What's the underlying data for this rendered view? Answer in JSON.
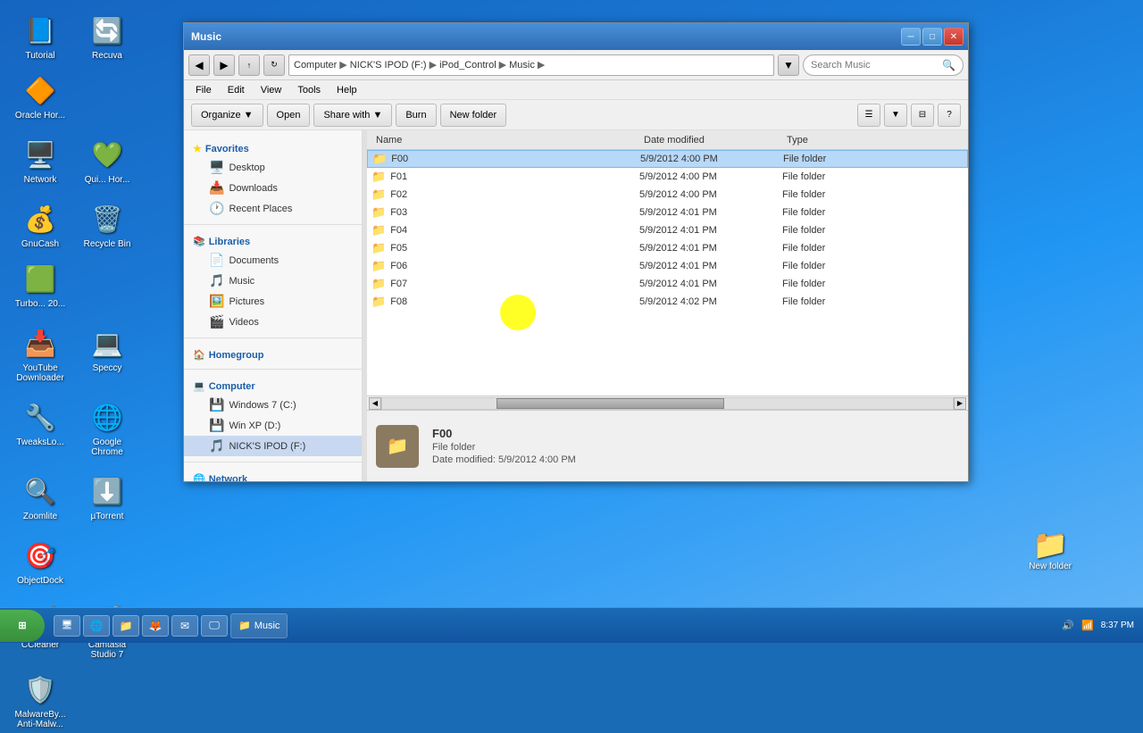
{
  "desktop": {
    "background_color": "#1976d2",
    "icons": [
      {
        "id": "tutorial",
        "label": "Tutorial",
        "icon": "📘"
      },
      {
        "id": "recuva",
        "label": "Recuva",
        "icon": "🔄"
      },
      {
        "id": "oracle",
        "label": "Oracle Hor...",
        "icon": "🔶"
      },
      {
        "id": "network",
        "label": "Network",
        "icon": "🖥️"
      },
      {
        "id": "quickbooks",
        "label": "Qui... Hor...",
        "icon": "💚"
      },
      {
        "id": "gnucash",
        "label": "GnuCash",
        "icon": "💰"
      },
      {
        "id": "recycle",
        "label": "Recycle Bin",
        "icon": "🗑️"
      },
      {
        "id": "turbotax",
        "label": "Turbo... 20...",
        "icon": "🟩"
      },
      {
        "id": "youtube",
        "label": "YouTube Downloader",
        "icon": "📥"
      },
      {
        "id": "speccy",
        "label": "Speccy",
        "icon": "💻"
      },
      {
        "id": "tweakslo",
        "label": "TweaksLo...",
        "icon": "🔧"
      },
      {
        "id": "chrome",
        "label": "Google Chrome",
        "icon": "🌐"
      },
      {
        "id": "zoomlite",
        "label": "Zoomlite",
        "icon": "🔍"
      },
      {
        "id": "utorrent",
        "label": "µTorrent",
        "icon": "⬇️"
      },
      {
        "id": "objectdock",
        "label": "ObjectDock",
        "icon": "🎯"
      },
      {
        "id": "ccleaner",
        "label": "CCleaner",
        "icon": "🧹"
      },
      {
        "id": "camtasia",
        "label": "Camtasia Studio 7",
        "icon": "🎬"
      },
      {
        "id": "malwarebytes",
        "label": "MalwareBy... Anti-Malw...",
        "icon": "🛡️"
      }
    ],
    "new_folder": {
      "label": "New folder",
      "icon": "📁"
    },
    "taskbar": {
      "start_label": "⊞",
      "items": [
        {
          "id": "explorer",
          "label": "Music",
          "icon": "📁"
        }
      ],
      "time": "8:37 PM"
    }
  },
  "window": {
    "title": "Music",
    "breadcrumb": {
      "parts": [
        "Computer",
        "NICK'S IPOD (F:)",
        "iPod_Control",
        "Music"
      ]
    },
    "search_placeholder": "Search Music",
    "menu": [
      "File",
      "Edit",
      "View",
      "Tools",
      "Help"
    ],
    "toolbar": {
      "organize": "Organize",
      "open": "Open",
      "share_with": "Share with",
      "burn": "Burn",
      "new_folder": "New folder"
    },
    "nav_pane": {
      "favorites": {
        "title": "Favorites",
        "items": [
          {
            "id": "desktop",
            "label": "Desktop",
            "icon": "🖥️"
          },
          {
            "id": "downloads",
            "label": "Downloads",
            "icon": "📥"
          },
          {
            "id": "recent",
            "label": "Recent Places",
            "icon": "🕐"
          }
        ]
      },
      "libraries": {
        "title": "Libraries",
        "items": [
          {
            "id": "documents",
            "label": "Documents",
            "icon": "📄"
          },
          {
            "id": "music",
            "label": "Music",
            "icon": "🎵"
          },
          {
            "id": "pictures",
            "label": "Pictures",
            "icon": "🖼️"
          },
          {
            "id": "videos",
            "label": "Videos",
            "icon": "🎬"
          }
        ]
      },
      "homegroup": {
        "title": "Homegroup",
        "items": []
      },
      "computer": {
        "title": "Computer",
        "items": [
          {
            "id": "win7",
            "label": "Windows 7 (C:)",
            "icon": "💾"
          },
          {
            "id": "winxp",
            "label": "Win XP (D:)",
            "icon": "💾"
          },
          {
            "id": "nickipod",
            "label": "NICK'S IPOD (F:)",
            "icon": "🎵",
            "selected": true
          }
        ]
      },
      "network": {
        "title": "Network",
        "items": []
      }
    },
    "file_list": {
      "columns": [
        {
          "id": "name",
          "label": "Name"
        },
        {
          "id": "date_modified",
          "label": "Date modified"
        },
        {
          "id": "type",
          "label": "Type"
        }
      ],
      "files": [
        {
          "name": "F00",
          "date": "5/9/2012 4:00 PM",
          "type": "File folder",
          "selected": true
        },
        {
          "name": "F01",
          "date": "5/9/2012 4:00 PM",
          "type": "File folder"
        },
        {
          "name": "F02",
          "date": "5/9/2012 4:00 PM",
          "type": "File folder"
        },
        {
          "name": "F03",
          "date": "5/9/2012 4:01 PM",
          "type": "File folder"
        },
        {
          "name": "F04",
          "date": "5/9/2012 4:01 PM",
          "type": "File folder"
        },
        {
          "name": "F05",
          "date": "5/9/2012 4:01 PM",
          "type": "File folder"
        },
        {
          "name": "F06",
          "date": "5/9/2012 4:01 PM",
          "type": "File folder"
        },
        {
          "name": "F07",
          "date": "5/9/2012 4:01 PM",
          "type": "File folder"
        },
        {
          "name": "F08",
          "date": "5/9/2012 4:02 PM",
          "type": "File folder"
        }
      ]
    },
    "status_bar": {
      "selected_name": "F00",
      "selected_type": "File folder",
      "selected_date_label": "Date modified:",
      "selected_date": "5/9/2012 4:00 PM"
    }
  }
}
